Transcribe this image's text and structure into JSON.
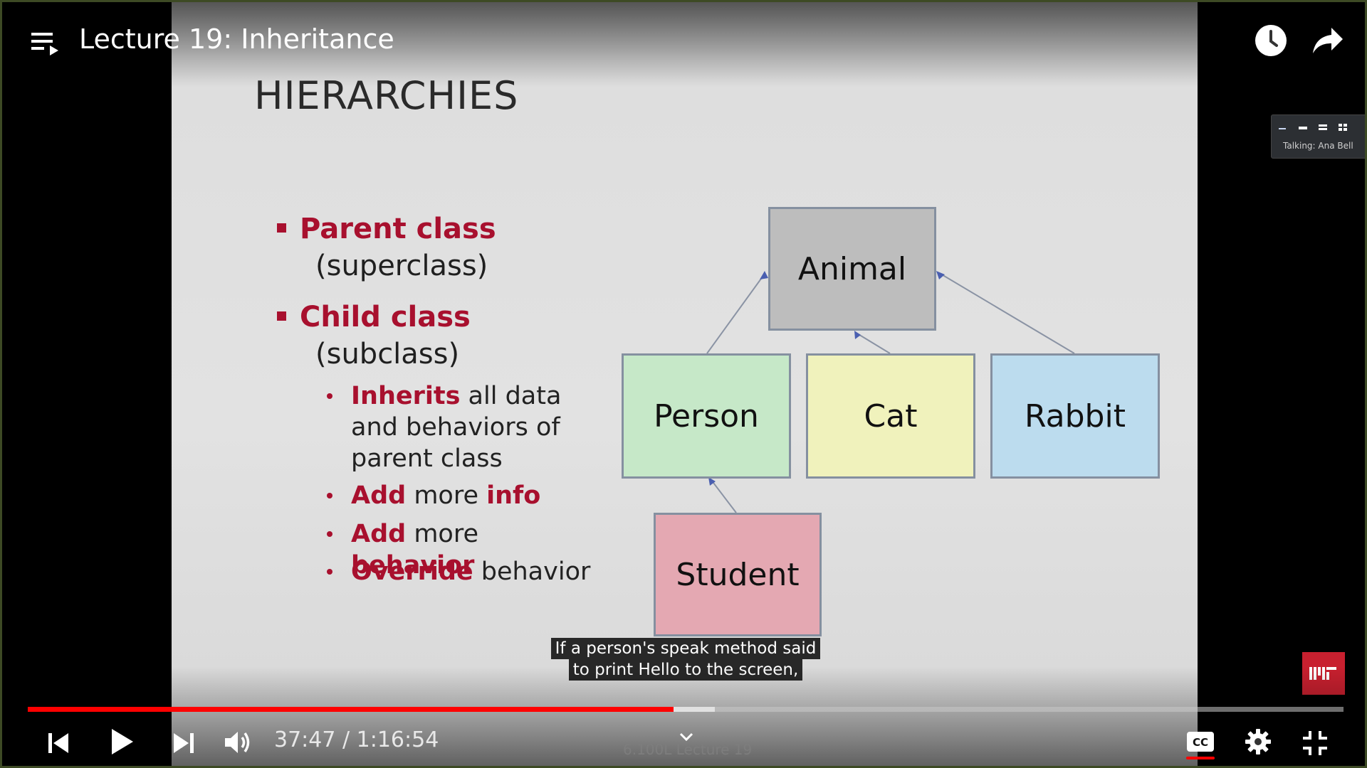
{
  "header": {
    "title": "Lecture 19: Inheritance",
    "playlist_icon": "playlist-icon",
    "watch_later_icon": "clock-icon",
    "share_icon": "share-icon"
  },
  "slide": {
    "title": "HIERARCHIES",
    "bullets": [
      {
        "label": "Parent class",
        "sub": "(superclass)"
      },
      {
        "label": "Child class",
        "sub": "(subclass)"
      }
    ],
    "sub_bullets": [
      {
        "parts": [
          {
            "text": "Inherits",
            "red": true
          },
          {
            "text": " all data and behaviors of parent class",
            "red": false
          }
        ]
      },
      {
        "parts": [
          {
            "text": "Add",
            "red": true
          },
          {
            "text": " more ",
            "red": false
          },
          {
            "text": "info",
            "red": true
          }
        ]
      },
      {
        "parts": [
          {
            "text": "Add",
            "red": true
          },
          {
            "text": " more ",
            "red": false
          },
          {
            "text": "behavior",
            "red": true
          }
        ]
      },
      {
        "parts": [
          {
            "text": "Override",
            "red": true
          },
          {
            "text": " behavior",
            "red": false
          }
        ]
      }
    ],
    "diagram": {
      "animal": "Animal",
      "person": "Person",
      "cat": "Cat",
      "rabbit": "Rabbit",
      "student": "Student"
    },
    "footer": "6.100L Lecture 19"
  },
  "mini_window": {
    "text": "Talking: Ana Bell"
  },
  "caption": {
    "line1": "If a person's speak method said",
    "line2": "to print Hello to the screen,"
  },
  "player": {
    "time_current": "37:47",
    "time_total": "1:16:54",
    "time_display": "37:47 / 1:16:54",
    "played_fraction": 0.491,
    "buffered_fraction": 0.522,
    "colors": {
      "progress": "#ff0000",
      "logo": "#c8202f",
      "accent_red": "#a8102e"
    }
  }
}
